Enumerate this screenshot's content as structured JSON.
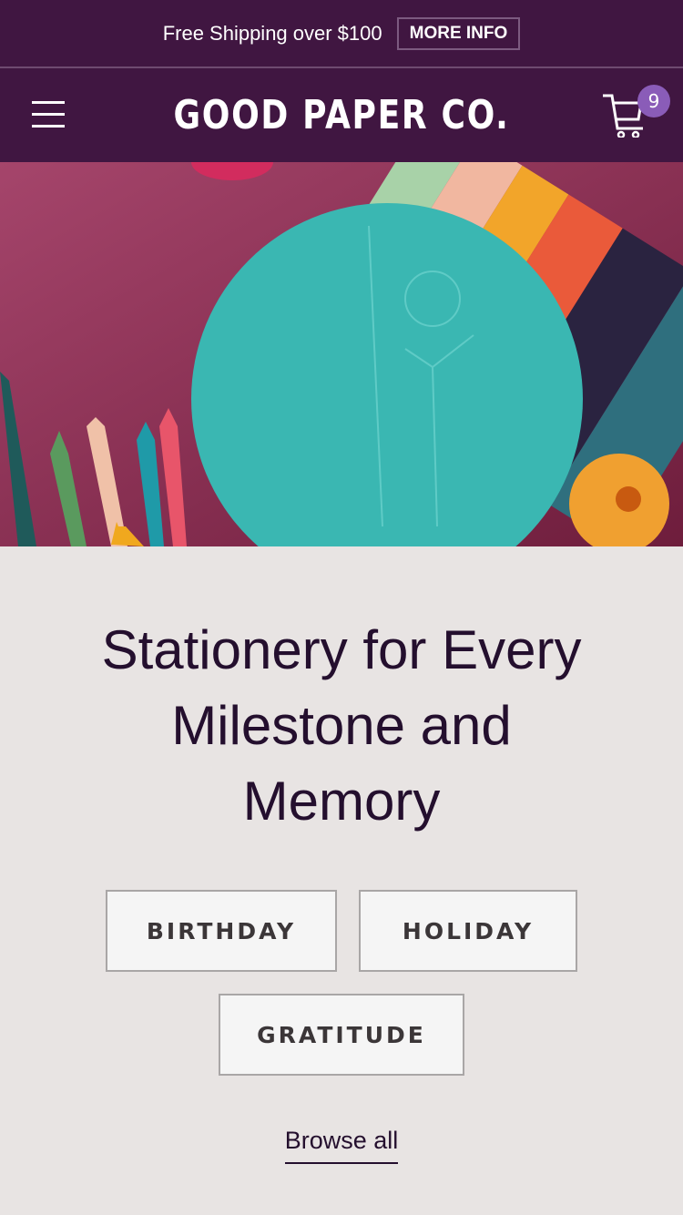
{
  "announcement": {
    "text": "Free Shipping over $100",
    "button": "MORE INFO"
  },
  "header": {
    "logo": "GOOD PAPER CO.",
    "cart_count": "9",
    "icons": [
      "menu-icon",
      "search-icon",
      "cart-icon"
    ]
  },
  "hero": {
    "headline": "Stationery for Every Milestone and Memory"
  },
  "categories": [
    {
      "label": "BIRTHDAY"
    },
    {
      "label": "HOLIDAY"
    },
    {
      "label": "GRATITUDE"
    }
  ],
  "browse_all": "Browse all",
  "colors": {
    "header_bg": "#401641",
    "badge": "#8a5cb8",
    "page_bg": "#e8e4e3",
    "text": "#240f2e"
  }
}
